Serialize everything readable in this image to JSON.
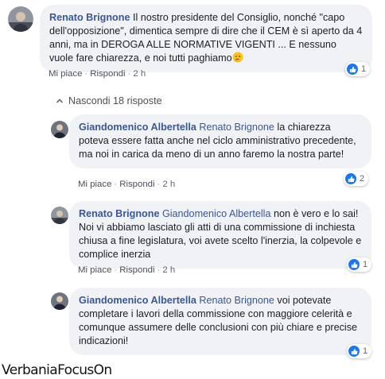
{
  "comment": {
    "author": "Renato Brignone",
    "text": "Il nostro presidente del Consiglio, nonché \"capo dell'opposizione\", dimentica sempre di dire che il CEM è sì aperto da 4 anni, ma in DEROGA ALLE NORMATIVE VIGENTI ... E nessuno vuole fare chiarezza, e noi tutti paghiamo",
    "emoji": "thinking-face",
    "like_label": "Mi piace",
    "reply_label": "Rispondi",
    "time": "2 h",
    "likes": "1"
  },
  "replies_toggle": "Nascondi 18 risposte",
  "replies": [
    {
      "author": "Giandomenico Albertella",
      "tag": "Renato Brignone",
      "text": "la chiarezza poteva essere fatta anche nel ciclo amministrativo precedente, ma noi in carica da meno di un anno faremo la nostra parte!",
      "like_label": "Mi piace",
      "reply_label": "Rispondi",
      "time": "2 h",
      "likes": "2"
    },
    {
      "author": "Renato Brignone",
      "tag": "Giandomenico Albertella",
      "text": "non è vero e lo sai! Noi vi abbiamo lasciato gli atti di una commissione di inchiesta chiusa a fine legislatura, voi avete scelto l'inerzia, la colpevole e complice inerzia",
      "like_label": "Mi piace",
      "reply_label": "Rispondi",
      "time": "2 h",
      "likes": "1"
    },
    {
      "author": "Giandomenico Albertella",
      "tag": "Renato Brignone",
      "text": "voi potevate completare i lavori della commissione con maggiore celerità e comunque assumere delle conclusioni con più chiare e precise indicazioni!",
      "like_label": "Mi piace",
      "reply_label": "Rispondi",
      "time": "2 h",
      "likes": "1"
    }
  ],
  "watermark": "VerbaniaFocusOn",
  "colors": {
    "name_link": "#385898",
    "bubble_bg": "#f0f2f5",
    "meta_text": "#606770",
    "like_blue": "#1877f2"
  }
}
